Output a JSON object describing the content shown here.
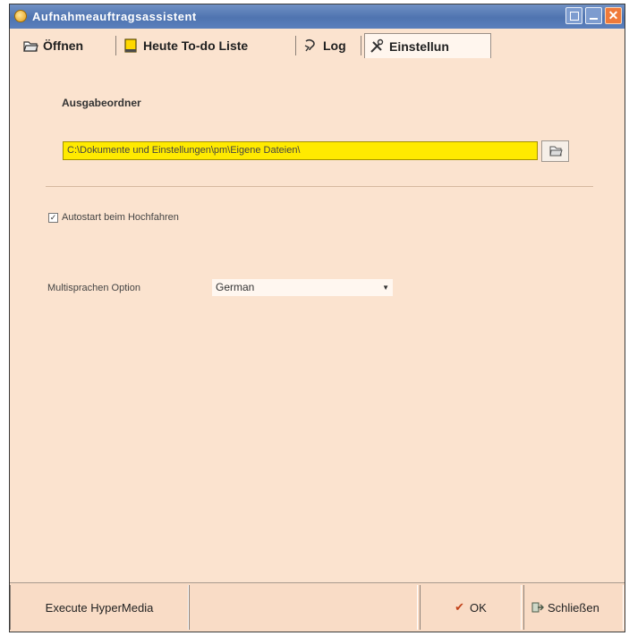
{
  "window": {
    "title": "Aufnahmeauftragsassistent",
    "close_glyph": "✕"
  },
  "tabs": [
    {
      "label": "Öffnen",
      "icon": "open-folder-icon"
    },
    {
      "label": "Heute To-do Liste",
      "icon": "notepad-icon"
    },
    {
      "label": "Log",
      "icon": "log-icon"
    },
    {
      "label": "Einstellun",
      "icon": "tools-icon",
      "active": true
    }
  ],
  "settings": {
    "output_folder_label": "Ausgabeordner",
    "output_folder_value": "C:\\Dokumente und Einstellungen\\pm\\Eigene Dateien\\",
    "auto_start_label": "Autostart beim Hochfahren",
    "auto_start_checked": true,
    "check_glyph": "✓",
    "language_label": "Multisprachen Option",
    "language_value": "German",
    "dropdown_glyph": "▼"
  },
  "footer": {
    "execute_label": "Execute HyperMedia",
    "ok_label": "OK",
    "ok_glyph": "✔",
    "close_label": "Schließen"
  },
  "colors": {
    "background": "#fbe3cf",
    "titlebar": "#5a7fbc",
    "path_highlight": "#ffea00"
  }
}
